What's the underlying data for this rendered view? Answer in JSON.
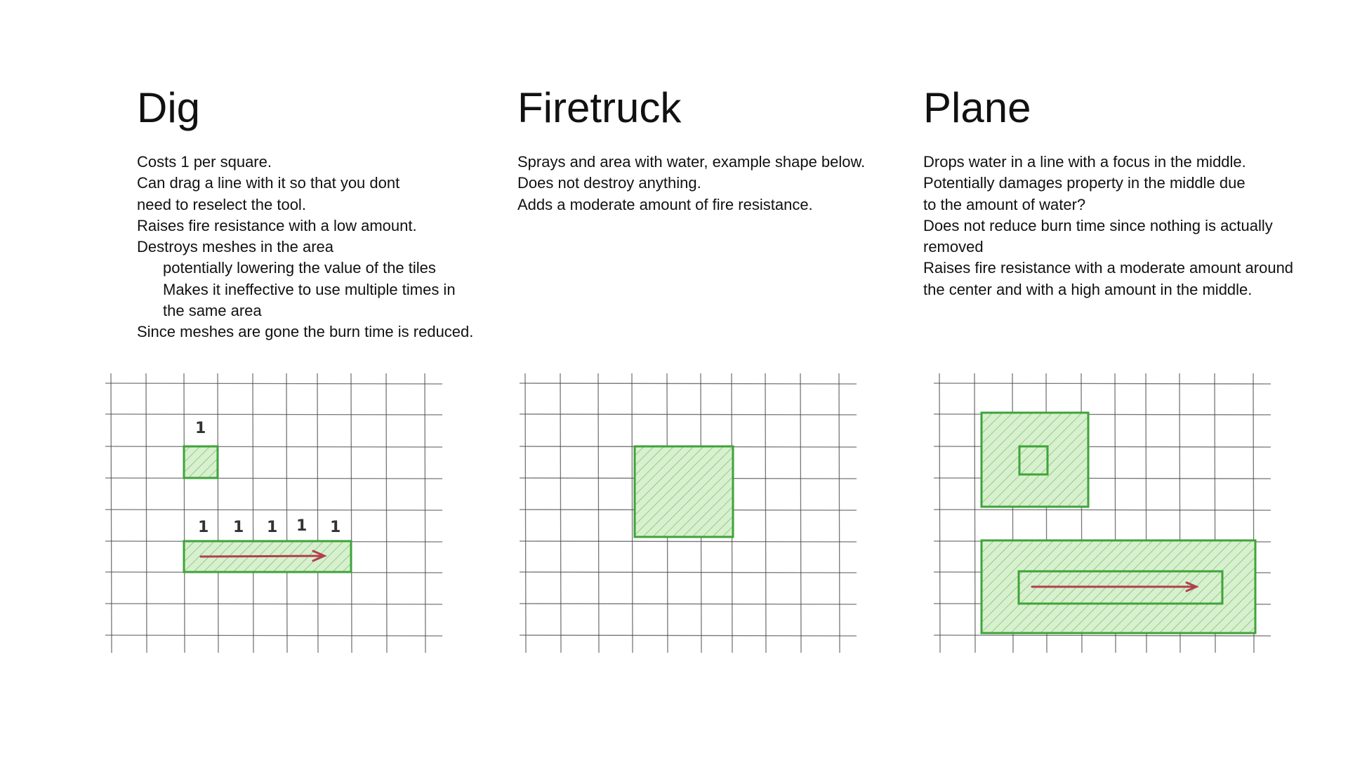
{
  "columns": [
    {
      "id": "dig",
      "title": "Dig",
      "lines": [
        {
          "text": "Costs 1 per square.",
          "indent": false
        },
        {
          "text": "Can drag a line with it so that you dont",
          "indent": false
        },
        {
          "text": "need to reselect the tool.",
          "indent": false
        },
        {
          "text": "Raises fire resistance with a low amount.",
          "indent": false
        },
        {
          "text": "Destroys meshes in the area",
          "indent": false
        },
        {
          "text": "potentially lowering the value of the tiles",
          "indent": true
        },
        {
          "text": "Makes it ineffective to use multiple times in",
          "indent": true
        },
        {
          "text": "the same area",
          "indent": true
        },
        {
          "text": "Since meshes are gone the burn time is reduced.",
          "indent": false
        }
      ],
      "sketch": {
        "cost_labels": [
          "1",
          "1",
          "1",
          "1",
          "1",
          "1"
        ]
      }
    },
    {
      "id": "firetruck",
      "title": "Firetruck",
      "lines": [
        {
          "text": "Sprays and area with water, example shape below.",
          "indent": false
        },
        {
          "text": "Does not destroy anything.",
          "indent": false
        },
        {
          "text": "Adds a moderate amount of fire resistance.",
          "indent": false
        }
      ]
    },
    {
      "id": "plane",
      "title": "Plane",
      "lines": [
        {
          "text": "Drops water in a line with a focus in the middle.",
          "indent": false
        },
        {
          "text": "Potentially damages property in the middle due",
          "indent": false
        },
        {
          "text": "to the amount of water?",
          "indent": false
        },
        {
          "text": "Does not reduce burn time since nothing is actually",
          "indent": false
        },
        {
          "text": "removed",
          "indent": false
        },
        {
          "text": "Raises fire resistance with a moderate amount around",
          "indent": false
        },
        {
          "text": "the center and with a high amount in the middle.",
          "indent": false
        }
      ]
    }
  ],
  "colors": {
    "grid": "#4a4a4a",
    "area_stroke": "#3fa33a",
    "area_fill": "#d8f0cf",
    "area_hatch": "#6cc45e",
    "arrow": "#b0404c"
  }
}
